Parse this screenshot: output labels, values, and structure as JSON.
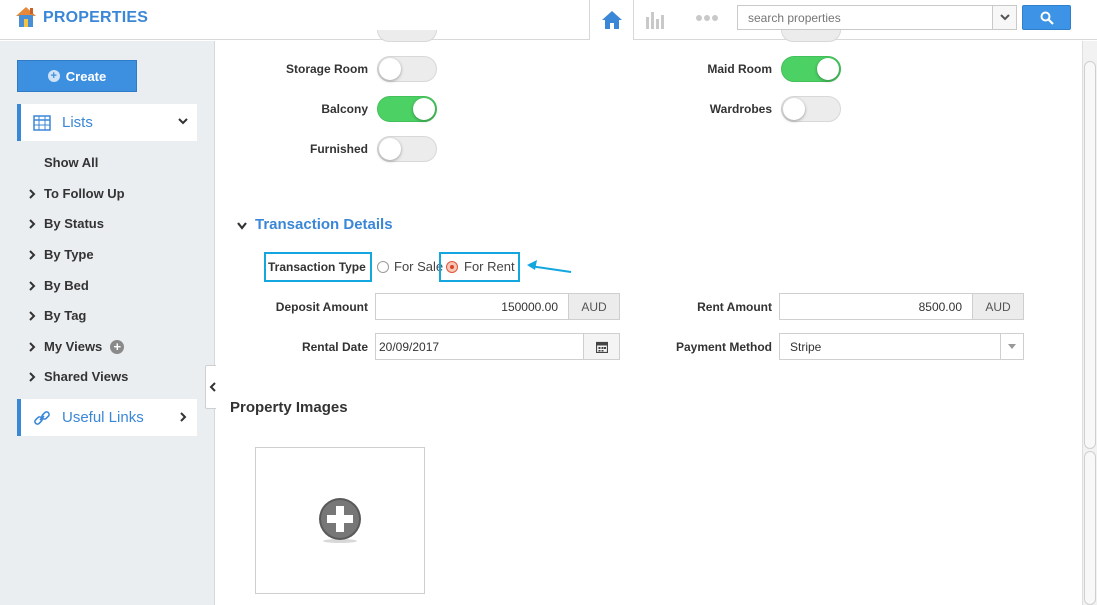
{
  "app": {
    "title": "PROPERTIES"
  },
  "header": {
    "search_placeholder": "search properties",
    "icons": [
      "home-icon",
      "chart-icon",
      "more-dots-icon",
      "chevron-down-icon",
      "search-icon"
    ]
  },
  "sidebar": {
    "create_label": "Create",
    "lists_label": "Lists",
    "items": [
      {
        "label": "Show All",
        "has_chevron": false
      },
      {
        "label": "To Follow Up",
        "has_chevron": true
      },
      {
        "label": "By Status",
        "has_chevron": true
      },
      {
        "label": "By Type",
        "has_chevron": true
      },
      {
        "label": "By Bed",
        "has_chevron": true
      },
      {
        "label": "By Tag",
        "has_chevron": true
      },
      {
        "label": "My Views",
        "has_chevron": true
      },
      {
        "label": "Shared Views",
        "has_chevron": true
      }
    ],
    "useful_links_label": "Useful Links"
  },
  "features": {
    "storage_room": {
      "label": "Storage Room",
      "on": false
    },
    "maid_room": {
      "label": "Maid Room",
      "on": true
    },
    "balcony": {
      "label": "Balcony",
      "on": true
    },
    "wardrobes": {
      "label": "Wardrobes",
      "on": false
    },
    "furnished": {
      "label": "Furnished",
      "on": false
    }
  },
  "transaction": {
    "section_title": "Transaction Details",
    "type_label": "Transaction Type",
    "option_sale": "For Sale",
    "option_rent": "For Rent",
    "selected": "For Rent",
    "deposit_label": "Deposit Amount",
    "deposit_value": "150000.00",
    "deposit_currency": "AUD",
    "rent_label": "Rent Amount",
    "rent_value": "8500.00",
    "rent_currency": "AUD",
    "rental_date_label": "Rental Date",
    "rental_date_value": "20/09/2017",
    "payment_label": "Payment Method",
    "payment_value": "Stripe"
  },
  "images": {
    "title": "Property Images"
  },
  "colors": {
    "accent": "#3b87d7",
    "toggle_on": "#4cd164",
    "highlight": "#14a6df",
    "radio_selected": "#d8452a"
  }
}
